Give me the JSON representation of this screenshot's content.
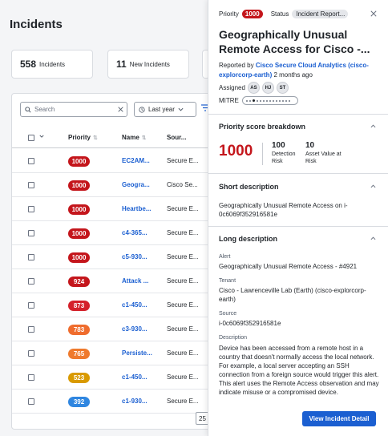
{
  "page": {
    "title": "Incidents",
    "stats": [
      {
        "count": "558",
        "label": "Incidents"
      },
      {
        "count": "11",
        "label": "New Incidents"
      }
    ],
    "search_placeholder": "Search",
    "time_filter": "Last year",
    "columns": [
      "Priority",
      "Name",
      "Sour..."
    ],
    "rows": [
      {
        "priority": "1000",
        "color": "#c4161c",
        "name": "EC2AM...",
        "source": "Secure E..."
      },
      {
        "priority": "1000",
        "color": "#c4161c",
        "name": "Geogra...",
        "source": "Cisco Se..."
      },
      {
        "priority": "1000",
        "color": "#c4161c",
        "name": "Heartbe...",
        "source": "Secure E..."
      },
      {
        "priority": "1000",
        "color": "#c4161c",
        "name": "c4-365...",
        "source": "Secure E..."
      },
      {
        "priority": "1000",
        "color": "#c4161c",
        "name": "c5-930...",
        "source": "Secure E..."
      },
      {
        "priority": "924",
        "color": "#c4161c",
        "name": "Attack ...",
        "source": "Secure E..."
      },
      {
        "priority": "873",
        "color": "#d4212b",
        "name": "c1-450...",
        "source": "Secure E..."
      },
      {
        "priority": "783",
        "color": "#ef6c2d",
        "name": "c3-930...",
        "source": "Secure E..."
      },
      {
        "priority": "765",
        "color": "#ef7a2d",
        "name": "Persiste...",
        "source": "Secure E..."
      },
      {
        "priority": "523",
        "color": "#d99a00",
        "name": "c1-450...",
        "source": "Secure E..."
      },
      {
        "priority": "392",
        "color": "#2f86e0",
        "name": "c1-930...",
        "source": "Secure E..."
      }
    ],
    "page_size": "25"
  },
  "drawer": {
    "priority_label": "Priority",
    "priority_value": "1000",
    "status_label": "Status",
    "status_value": "Incident Report...",
    "title": "Geographically Unusual Remote Access for Cisco -...",
    "reported_prefix": "Reported by",
    "reported_by": "Cisco Secure Cloud Analytics (cisco-explorcorp-earth)",
    "reported_when": "2 months ago",
    "assigned_label": "Assigned",
    "assignees": [
      "AS",
      "HJ",
      "ST"
    ],
    "mitre_label": "MITRE",
    "score_section": "Priority score breakdown",
    "score_total": "1000",
    "score_detection_value": "100",
    "score_detection_label": "Detection Risk",
    "score_asset_value": "10",
    "score_asset_label": "Asset Value at Risk",
    "short_desc_title": "Short description",
    "short_desc": "Geographically Unusual Remote Access on i-0c6069f352916581e",
    "long_desc_title": "Long description",
    "alert_label": "Alert",
    "alert_value": "Geographically Unusual Remote Access - #4921",
    "tenant_label": "Tenant",
    "tenant_value": "Cisco - Lawrenceville Lab (Earth) (cisco-explorcorp-earth)",
    "source_label": "Source",
    "source_value": "i-0c6069f352916581e",
    "description_label": "Description",
    "description_value": "Device has been accessed from a remote host in a country that doesn't normally access the local network. For example, a local server accepting an SSH connection from a foreign source would trigger this alert. This alert uses the Remote Access observation and may indicate misuse or a compromised device.",
    "view_button": "View Incident Detail"
  }
}
